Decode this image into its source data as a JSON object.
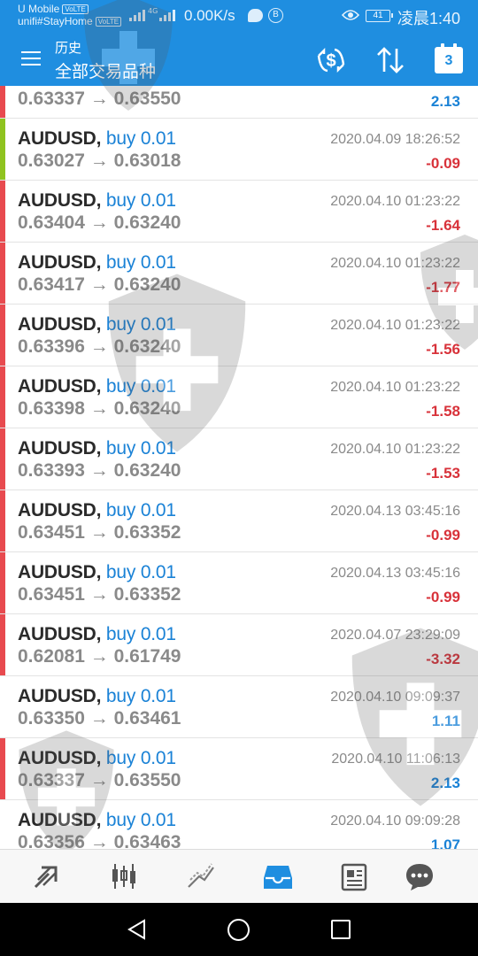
{
  "status_bar": {
    "carrier_line1": "U Mobile",
    "carrier_line2": "unifi#StayHome",
    "volte": "VoLTE",
    "network": "4G",
    "speed": "0.00K/s",
    "b_badge": "B",
    "battery": "41",
    "time": "凌晨1:40"
  },
  "app_bar": {
    "title": "历史",
    "subtitle": "全部交易品种",
    "icons": [
      "menu-icon",
      "dollar-exchange-icon",
      "sort-icon",
      "calendar-icon"
    ],
    "calendar_day": "3"
  },
  "colors": {
    "accent": "#1f8ee0",
    "loss": "#d8323a",
    "gain": "#1a82d6",
    "bar_loss": "#e84a4f",
    "bar_green": "#8fc31f"
  },
  "rows": [
    {
      "symbol": "",
      "side": "",
      "prices": "0.63337 → 0.63550",
      "time": "",
      "profit": "2.13",
      "sign": "pos",
      "bar": "#e84a4f"
    },
    {
      "symbol": "AUDUSD,",
      "side": "buy 0.01",
      "prices": "0.63027 → 0.63018",
      "time": "2020.04.09 18:26:52",
      "profit": "-0.09",
      "sign": "neg",
      "bar": "#8fc31f"
    },
    {
      "symbol": "AUDUSD,",
      "side": "buy 0.01",
      "prices": "0.63404 → 0.63240",
      "time": "2020.04.10 01:23:22",
      "profit": "-1.64",
      "sign": "neg",
      "bar": "#e84a4f"
    },
    {
      "symbol": "AUDUSD,",
      "side": "buy 0.01",
      "prices": "0.63417 → 0.63240",
      "time": "2020.04.10 01:23:22",
      "profit": "-1.77",
      "sign": "neg",
      "bar": "#e84a4f"
    },
    {
      "symbol": "AUDUSD,",
      "side": "buy 0.01",
      "prices": "0.63396 → 0.63240",
      "time": "2020.04.10 01:23:22",
      "profit": "-1.56",
      "sign": "neg",
      "bar": "#e84a4f"
    },
    {
      "symbol": "AUDUSD,",
      "side": "buy 0.01",
      "prices": "0.63398 → 0.63240",
      "time": "2020.04.10 01:23:22",
      "profit": "-1.58",
      "sign": "neg",
      "bar": "#e84a4f"
    },
    {
      "symbol": "AUDUSD,",
      "side": "buy 0.01",
      "prices": "0.63393 → 0.63240",
      "time": "2020.04.10 01:23:22",
      "profit": "-1.53",
      "sign": "neg",
      "bar": "#e84a4f"
    },
    {
      "symbol": "AUDUSD,",
      "side": "buy 0.01",
      "prices": "0.63451 → 0.63352",
      "time": "2020.04.13 03:45:16",
      "profit": "-0.99",
      "sign": "neg",
      "bar": "#e84a4f"
    },
    {
      "symbol": "AUDUSD,",
      "side": "buy 0.01",
      "prices": "0.63451 → 0.63352",
      "time": "2020.04.13 03:45:16",
      "profit": "-0.99",
      "sign": "neg",
      "bar": "#e84a4f"
    },
    {
      "symbol": "AUDUSD,",
      "side": "buy 0.01",
      "prices": "0.62081 → 0.61749",
      "time": "2020.04.07 23:29:09",
      "profit": "-3.32",
      "sign": "neg",
      "bar": "#e84a4f"
    },
    {
      "symbol": "AUDUSD,",
      "side": "buy 0.01",
      "prices": "0.63350 → 0.63461",
      "time": "2020.04.10 09:09:37",
      "profit": "1.11",
      "sign": "pos",
      "bar": ""
    },
    {
      "symbol": "AUDUSD,",
      "side": "buy 0.01",
      "prices": "0.63337 → 0.63550",
      "time": "2020.04.10 11:06:13",
      "profit": "2.13",
      "sign": "pos",
      "bar": "#e84a4f"
    },
    {
      "symbol": "AUDUSD,",
      "side": "buy 0.01",
      "prices": "0.63356 → 0.63463",
      "time": "2020.04.10 09:09:28",
      "profit": "1.07",
      "sign": "pos",
      "bar": ""
    }
  ],
  "tab_bar": {
    "tabs": [
      {
        "icon": "quotes-icon",
        "active": false
      },
      {
        "icon": "chart-icon",
        "active": false
      },
      {
        "icon": "trade-icon",
        "active": false
      },
      {
        "icon": "history-icon",
        "active": true
      },
      {
        "icon": "news-icon",
        "active": false
      },
      {
        "icon": "chat-icon",
        "active": false
      }
    ]
  },
  "nav_bar": {
    "icons": [
      "back-icon",
      "home-icon",
      "recents-icon"
    ]
  }
}
